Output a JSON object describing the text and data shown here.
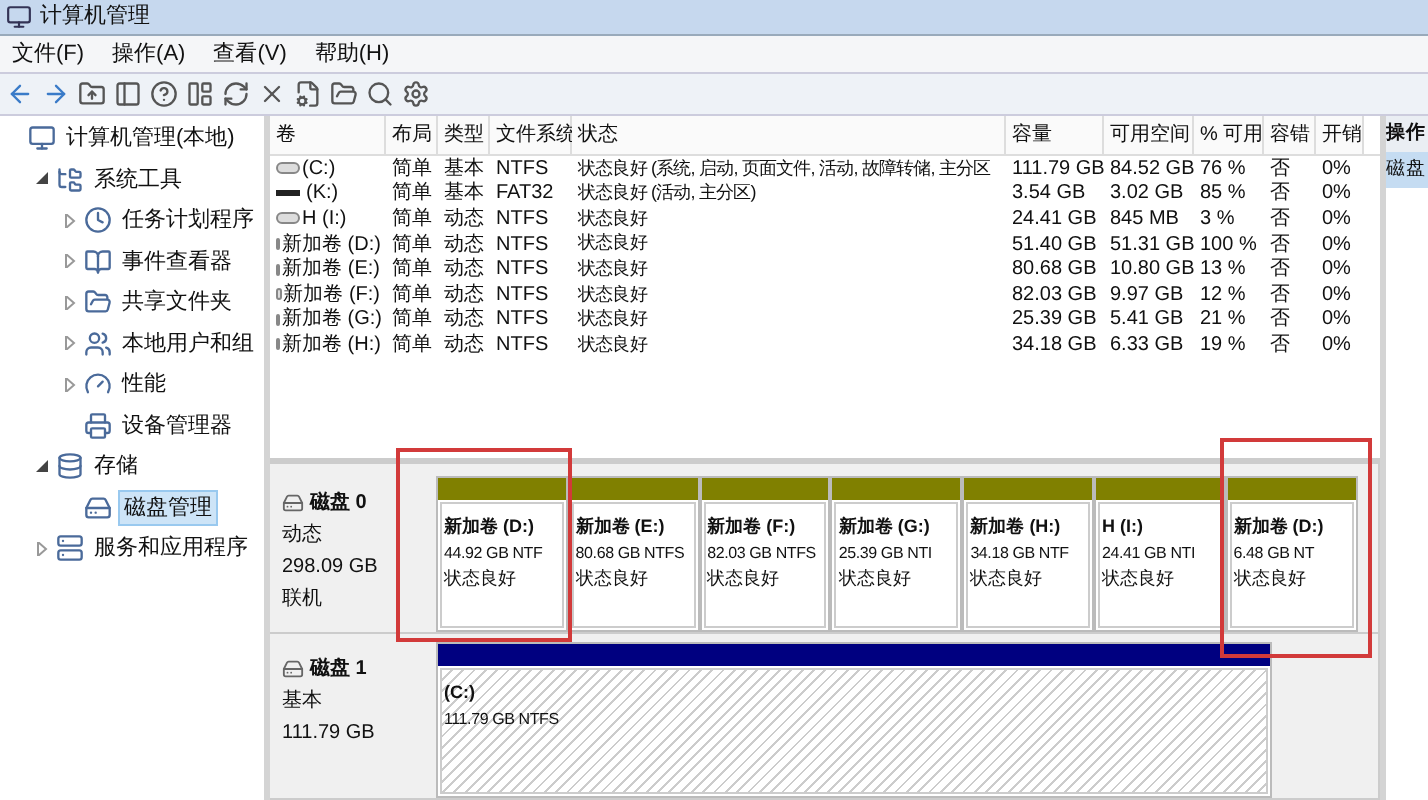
{
  "window": {
    "title": "计算机管理"
  },
  "menu": [
    "文件(F)",
    "操作(A)",
    "查看(V)",
    "帮助(H)"
  ],
  "tree": [
    {
      "label": "计算机管理(本地)",
      "selected": false,
      "children": [
        {
          "label": "系统工具",
          "selected": false,
          "expanded": true,
          "children": [
            {
              "label": "任务计划程序",
              "selected": false,
              "expanded": false
            },
            {
              "label": "事件查看器",
              "selected": false,
              "expanded": false
            },
            {
              "label": "共享文件夹",
              "selected": false,
              "expanded": false
            },
            {
              "label": "本地用户和组",
              "selected": false,
              "expanded": false
            },
            {
              "label": "性能",
              "selected": false,
              "expanded": false
            },
            {
              "label": "设备管理器",
              "selected": false
            }
          ]
        },
        {
          "label": "存储",
          "selected": false,
          "expanded": true,
          "children": [
            {
              "label": "磁盘管理",
              "selected": true
            }
          ]
        },
        {
          "label": "服务和应用程序",
          "selected": false,
          "expanded": false
        }
      ]
    }
  ],
  "table": {
    "columns": [
      "卷",
      "布局",
      "类型",
      "文件系统",
      "状态",
      "容量",
      "可用空间",
      "% 可用",
      "容错",
      "开销"
    ],
    "rows": [
      {
        "kind": "drive",
        "cells": [
          "(C:)",
          "简单",
          "基本",
          "NTFS",
          "状态良好 (系统, 启动, 页面文件, 活动, 故障转储, 主分区",
          "111.79 GB",
          "84.52 GB",
          "76 %",
          "否",
          "0%"
        ]
      },
      {
        "kind": "removable",
        "cells": [
          "(K:)",
          "简单",
          "基本",
          "FAT32",
          "状态良好 (活动, 主分区)",
          "3.54 GB",
          "3.02 GB",
          "85 %",
          "否",
          "0%"
        ]
      },
      {
        "kind": "drive",
        "cells": [
          "H (I:)",
          "简单",
          "动态",
          "NTFS",
          "状态良好",
          "24.41 GB",
          "845 MB",
          "3 %",
          "否",
          "0%"
        ]
      },
      {
        "kind": "drive",
        "cells": [
          "新加卷 (D:)",
          "简单",
          "动态",
          "NTFS",
          "状态良好",
          "51.40 GB",
          "51.31 GB",
          "100 %",
          "否",
          "0%"
        ]
      },
      {
        "kind": "drive",
        "cells": [
          "新加卷 (E:)",
          "简单",
          "动态",
          "NTFS",
          "状态良好",
          "80.68 GB",
          "10.80 GB",
          "13 %",
          "否",
          "0%"
        ]
      },
      {
        "kind": "drive",
        "cells": [
          "新加卷 (F:)",
          "简单",
          "动态",
          "NTFS",
          "状态良好",
          "82.03 GB",
          "9.97 GB",
          "12 %",
          "否",
          "0%"
        ]
      },
      {
        "kind": "drive",
        "cells": [
          "新加卷 (G:)",
          "简单",
          "动态",
          "NTFS",
          "状态良好",
          "25.39 GB",
          "5.41 GB",
          "21 %",
          "否",
          "0%"
        ]
      },
      {
        "kind": "drive",
        "cells": [
          "新加卷 (H:)",
          "简单",
          "动态",
          "NTFS",
          "状态良好",
          "34.18 GB",
          "6.33 GB",
          "19 %",
          "否",
          "0%"
        ]
      }
    ]
  },
  "disks": [
    {
      "name": "磁盘 0",
      "type": "动态",
      "size": "298.09 GB",
      "status": "联机",
      "partitions": [
        {
          "name": "新加卷 (D:)",
          "size": "44.92 GB NTF",
          "status": "状态良好",
          "color": "#808000",
          "selected": false
        },
        {
          "name": "新加卷 (E:)",
          "size": "80.68 GB NTFS",
          "status": "状态良好",
          "color": "#808000",
          "selected": false
        },
        {
          "name": "新加卷 (F:)",
          "size": "82.03 GB NTFS",
          "status": "状态良好",
          "color": "#808000",
          "selected": false
        },
        {
          "name": "新加卷 (G:)",
          "size": "25.39 GB NTI",
          "status": "状态良好",
          "color": "#808000",
          "selected": false
        },
        {
          "name": "新加卷 (H:)",
          "size": "34.18 GB NTF",
          "status": "状态良好",
          "color": "#808000",
          "selected": false
        },
        {
          "name": "H (I:)",
          "size": "24.41 GB NTI",
          "status": "状态良好",
          "color": "#808000",
          "selected": false
        },
        {
          "name": "新加卷 (D:)",
          "size": "6.48 GB NT",
          "status": "状态良好",
          "color": "#808000",
          "selected": false
        }
      ]
    },
    {
      "name": "磁盘 1",
      "type": "基本",
      "size": "111.79 GB",
      "partitions": [
        {
          "name": "(C:)",
          "size": "111.79 GB NTFS",
          "color": "#000080",
          "selected": true
        }
      ]
    }
  ],
  "actions": {
    "title": "操作",
    "items": [
      {
        "label": "磁盘",
        "selected": true
      }
    ]
  }
}
